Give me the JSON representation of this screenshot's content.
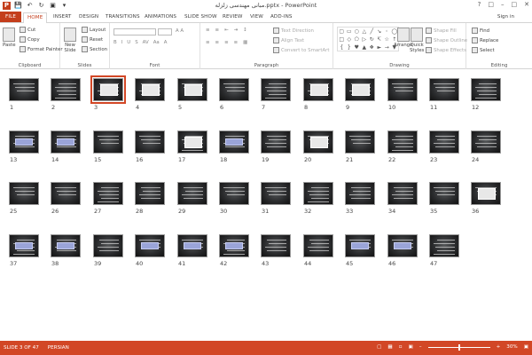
{
  "titlebar": {
    "title": "مبانی مهندسی زلزله.pptx - PowerPoint",
    "app_label": "P"
  },
  "tabs": [
    {
      "label": "FILE"
    },
    {
      "label": "HOME"
    },
    {
      "label": "INSERT"
    },
    {
      "label": "DESIGN"
    },
    {
      "label": "TRANSITIONS"
    },
    {
      "label": "ANIMATIONS"
    },
    {
      "label": "SLIDE SHOW"
    },
    {
      "label": "REVIEW"
    },
    {
      "label": "VIEW"
    },
    {
      "label": "ADD-INS"
    }
  ],
  "signin": "Sign in",
  "ribbon": {
    "clipboard": {
      "label": "Clipboard",
      "paste": "Paste",
      "cut": "Cut",
      "copy": "Copy",
      "format_painter": "Format Painter"
    },
    "slides": {
      "label": "Slides",
      "new_slide": "New",
      "new_slide_2": "Slide",
      "layout": "Layout",
      "reset": "Reset",
      "section": "Section"
    },
    "font": {
      "label": "Font"
    },
    "paragraph": {
      "label": "Paragraph",
      "text_direction": "Text Direction",
      "align_text": "Align Text",
      "convert": "Convert to SmartArt"
    },
    "drawing": {
      "label": "Drawing",
      "arrange": "Arrange",
      "quick_styles": "Quick",
      "quick_styles_2": "Styles",
      "shape_fill": "Shape Fill",
      "shape_outline": "Shape Outline",
      "shape_effects": "Shape Effects"
    },
    "editing": {
      "label": "Editing",
      "find": "Find",
      "replace": "Replace",
      "select": "Select"
    }
  },
  "slides": {
    "count": 47,
    "selected": 3,
    "numbers": [
      "1",
      "2",
      "3",
      "4",
      "5",
      "6",
      "7",
      "8",
      "9",
      "10",
      "11",
      "12",
      "13",
      "14",
      "15",
      "16",
      "17",
      "18",
      "19",
      "20",
      "21",
      "22",
      "23",
      "24",
      "25",
      "26",
      "27",
      "28",
      "29",
      "30",
      "31",
      "32",
      "33",
      "34",
      "35",
      "36",
      "37",
      "38",
      "39",
      "40",
      "41",
      "42",
      "43",
      "44",
      "45",
      "46",
      "47"
    ]
  },
  "status": {
    "slide_info": "SLIDE 3 OF 47",
    "language": "PERSIAN",
    "zoom": "30%",
    "zoom_level": 0.5
  },
  "colors": {
    "accent": "#D24726",
    "file_tab": "#C43E1C"
  }
}
